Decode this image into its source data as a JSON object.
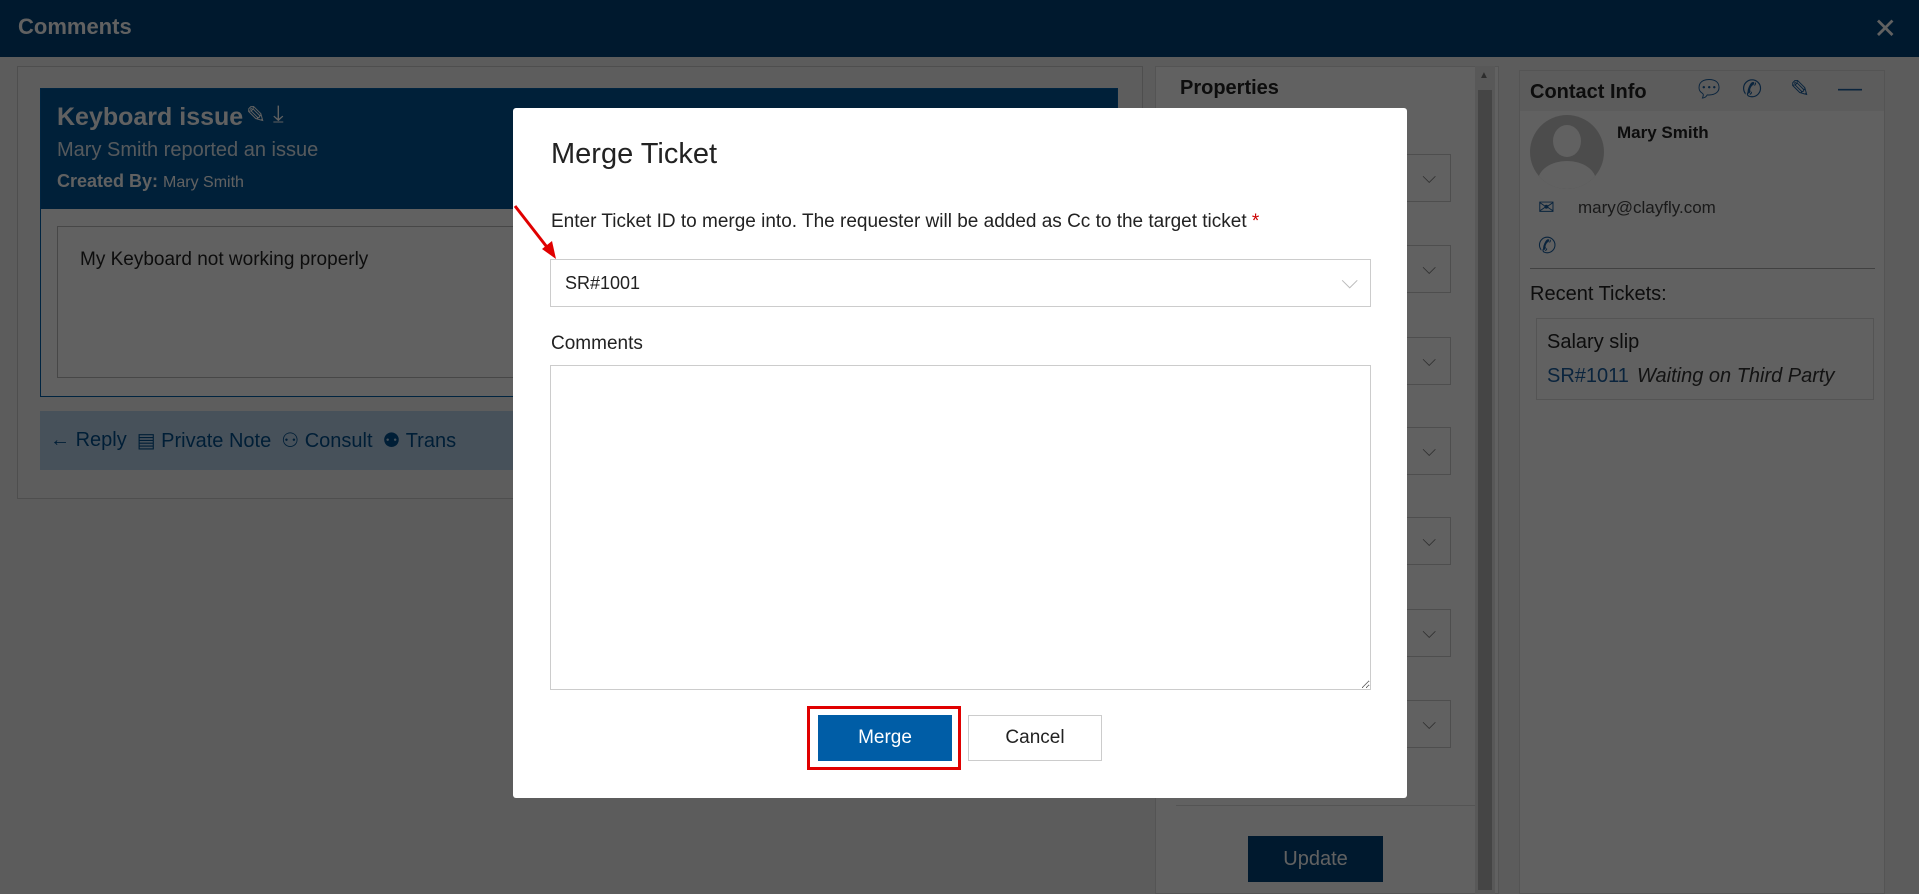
{
  "header": {
    "title": "Comments",
    "close_icon": "close-icon"
  },
  "ticket": {
    "title": "Keyboard issue",
    "subtitle": "Mary Smith reported an issue",
    "created_by_label": "Created By:",
    "created_by": "Mary Smith",
    "description": "My Keyboard not working properly"
  },
  "actions": [
    {
      "icon": "←",
      "label": "Reply"
    },
    {
      "icon": "▤",
      "label": "Private Note"
    },
    {
      "icon": "⚇",
      "label": "Consult"
    },
    {
      "icon": "⚉",
      "label": "Trans"
    }
  ],
  "properties": {
    "title": "Properties",
    "dropdown_count": 7,
    "update_label": "Update"
  },
  "contact": {
    "title": "Contact Info",
    "name": "Mary Smith",
    "email": "mary@clayfly.com",
    "recent_label": "Recent Tickets:",
    "recent": [
      {
        "title": "Salary slip",
        "id": "SR#1011",
        "status": "Waiting on Third Party"
      }
    ]
  },
  "dialog": {
    "title": "Merge Ticket",
    "label": "Enter Ticket ID to merge into. The requester will be added as Cc to the target ticket",
    "required": "*",
    "ticket_id": "SR#1001",
    "comments_label": "Comments",
    "comments_value": "",
    "merge_label": "Merge",
    "cancel_label": "Cancel"
  },
  "colors": {
    "brand": "#00427a",
    "accent": "#005da6",
    "highlight": "#e00000"
  }
}
